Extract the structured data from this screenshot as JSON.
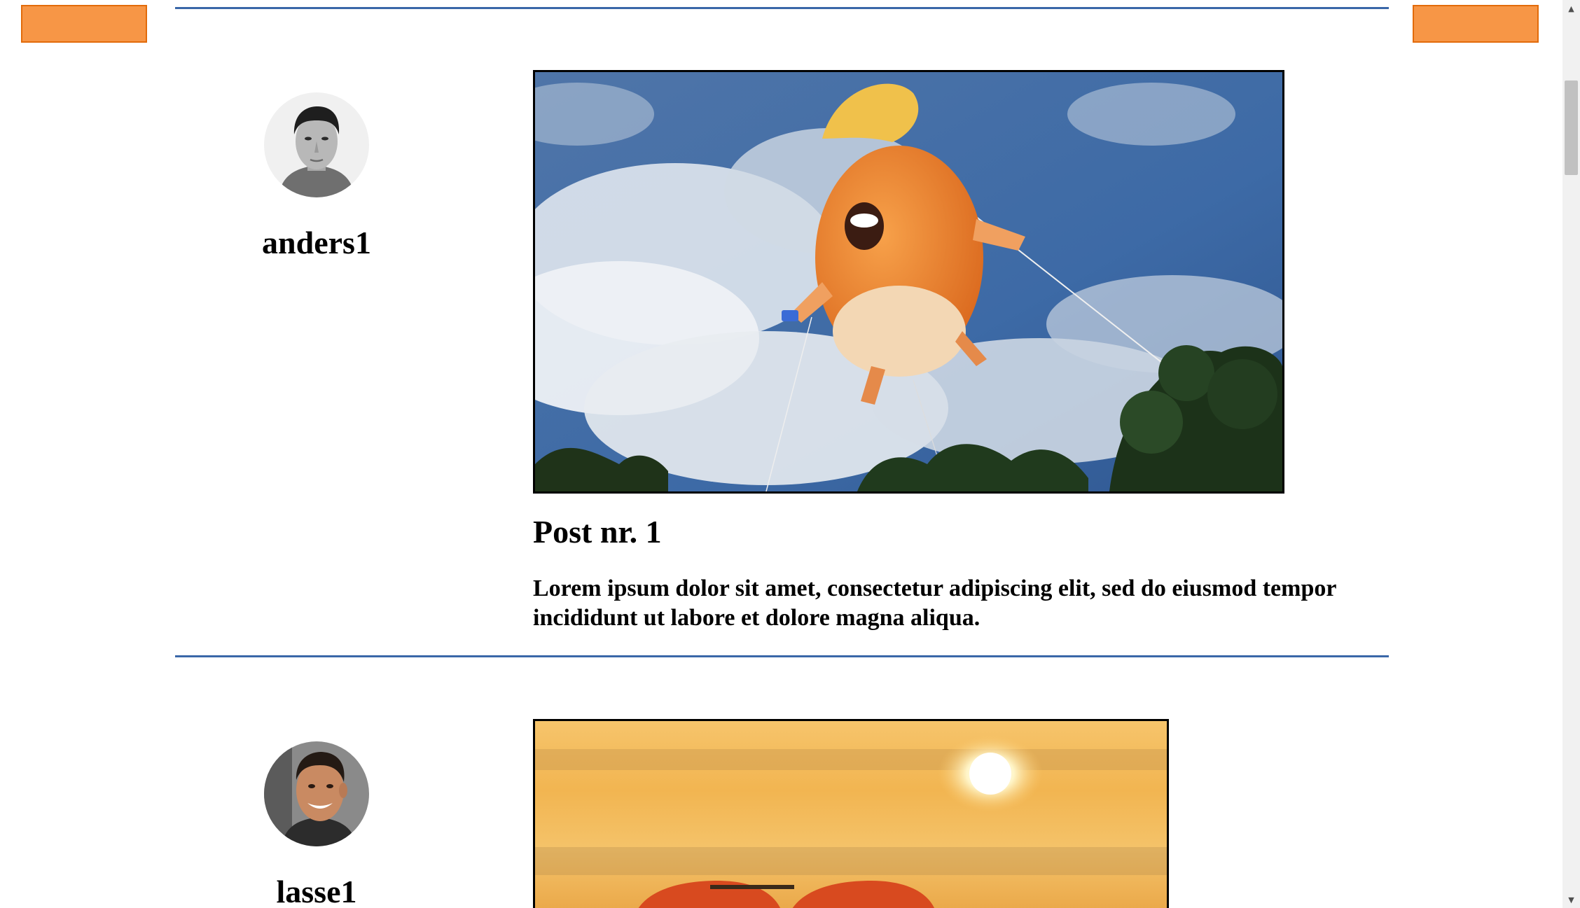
{
  "colors": {
    "accent_orange": "#F79646",
    "divider_blue": "#3A67A8",
    "image_border": "#000000",
    "background": "#FFFFFF"
  },
  "header": {
    "left_button_label": "",
    "right_button_label": ""
  },
  "posts": [
    {
      "username": "anders1",
      "title": "Post nr. 1",
      "body": "Lorem ipsum dolor sit amet, consectetur adipiscing elit, sed do eiusmod tempor incididunt ut labore et dolore magna aliqua.",
      "image_icon": "balloon-photo"
    },
    {
      "username": "lasse1",
      "title": "",
      "body": "",
      "image_icon": "sunset-sunglasses-photo"
    }
  ]
}
